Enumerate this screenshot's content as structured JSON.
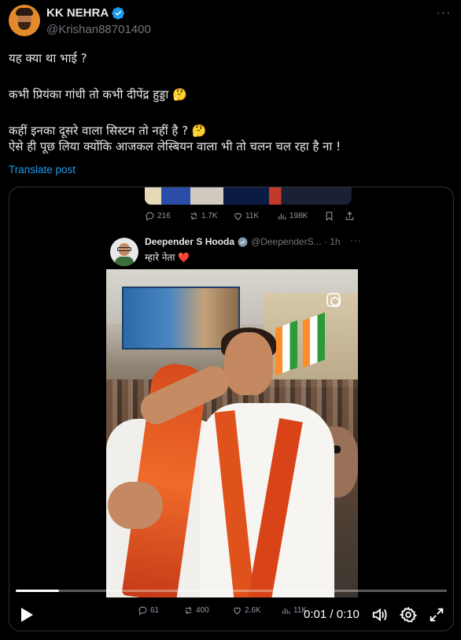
{
  "author": {
    "display_name": "KK NEHRA",
    "handle": "@Krishan88701400",
    "verified": true
  },
  "post": {
    "lines": [
      "यह क्या था भाई ?",
      "कभी प्रियंका गांधी तो कभी दीपेंद्र हुड्डा 🤔",
      "कहीं इनका दूसरे वाला सिस्टम तो नहीं है ?  🤔",
      "ऐसे ही पूछ लिया क्योंकि आजकल लेस्बियन वाला भी तो चलन चल रहा है ना !"
    ],
    "translate_label": "Translate post"
  },
  "previous_tweet_actions": {
    "replies": "216",
    "reposts": "1.7K",
    "likes": "11K",
    "views": "198K"
  },
  "quoted_tweet": {
    "display_name": "Deepender S Hooda",
    "handle_time": "@DeependerS... · 1h",
    "text": "म्हारे नेता ❤️",
    "actions": {
      "replies": "61",
      "reposts": "400",
      "likes": "2.6K",
      "views": "11K"
    }
  },
  "video": {
    "current_time": "0:01",
    "duration": "0:10",
    "time_display": "0:01 / 0:10",
    "progress_fraction": 0.1
  },
  "colors": {
    "accent": "#1d9bf0",
    "background": "#000000",
    "secondary_text": "#71767b"
  },
  "icons": {
    "verified": "verified-badge-icon",
    "more": "more-icon",
    "reply": "reply-icon",
    "repost": "repost-icon",
    "like": "like-icon",
    "views": "views-icon",
    "bookmark": "bookmark-icon",
    "share": "share-icon",
    "play": "play-icon",
    "volume": "volume-icon",
    "settings": "gear-icon",
    "fullscreen": "fullscreen-icon",
    "instagram": "instagram-icon"
  }
}
